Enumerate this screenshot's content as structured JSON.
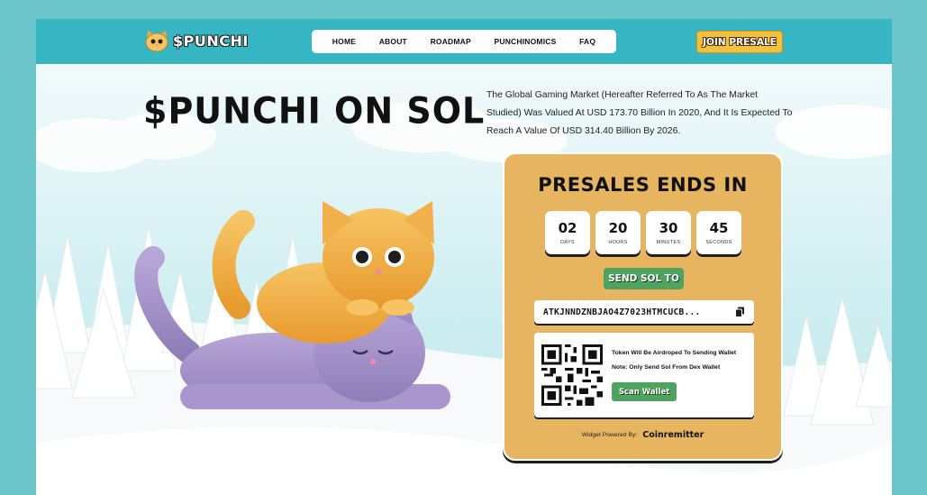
{
  "brand": {
    "name": "$PUNCHI",
    "logo_icon": "cat-face-icon"
  },
  "nav": {
    "items": [
      "HOME",
      "ABOUT",
      "ROADMAP",
      "PUNCHINOMICS",
      "FAQ"
    ]
  },
  "header": {
    "join_label": "JOIN PRESALE"
  },
  "hero": {
    "title": "$PUNCHI ON SOL",
    "description": "The Global Gaming Market (Hereafter Referred To As The Market Studied) Was Valued At USD 173.70 Billion In 2020, And It Is Expected To Reach A Value Of USD 314.40 Billion By 2026."
  },
  "presale": {
    "title": "PRESALES ENDS IN",
    "timer": [
      {
        "value": "02",
        "label": "DAYS"
      },
      {
        "value": "20",
        "label": "HOURS"
      },
      {
        "value": "30",
        "label": "MINUTES"
      },
      {
        "value": "45",
        "label": "SECONDS"
      }
    ],
    "send_label": "SEND SOL TO",
    "address": "ATKJNNDZNBJAO4Z7023HTMCUCB...",
    "note1": "Token Will Be Airdroped To Sending Wallet",
    "note2": "Note: Only Send Sol From Dex Wallet",
    "scan_label": "Scan Wallet",
    "powered_label": "Widget Powered By:",
    "powered_brand": "Coinremitter"
  },
  "colors": {
    "header": "#36b5c3",
    "card": "#e7b55f",
    "button_green": "#4fa35e",
    "join_yellow": "#f5c13a"
  }
}
